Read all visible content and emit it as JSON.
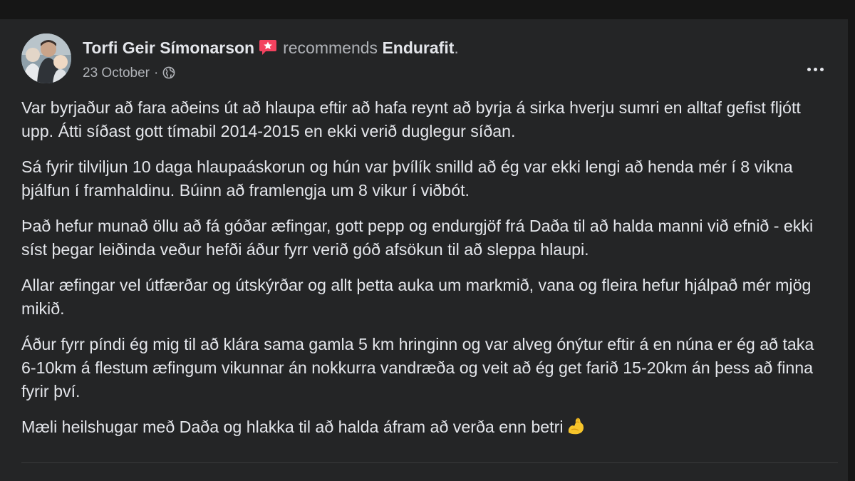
{
  "post": {
    "author": "Torfi Geir Símonarson",
    "action": "recommends",
    "page": "Endurafit",
    "page_suffix": ".",
    "date": "23 October",
    "separator": "·",
    "audience_icon": "globe-icon",
    "recommend_icon": "recommend-badge-icon",
    "more_icon": "more-options-icon",
    "paragraphs": [
      "Var byrjaður að fara aðeins út að hlaupa eftir að hafa reynt að byrja á sirka hverju sumri en alltaf gefist fljótt upp. Átti síðast gott tímabil 2014-2015 en ekki verið duglegur síðan.",
      "Sá fyrir tilviljun 10 daga hlaupaáskorun og hún var þvílík snilld að ég var ekki lengi að henda mér í 8 vikna þjálfun í framhaldinu. Búinn að framlengja um 8 vikur í viðbót.",
      "Það hefur munað öllu að fá góðar æfingar, gott pepp og endurgjöf frá Daða til að halda manni við efnið - ekki síst þegar leiðinda veður hefði áður fyrr verið góð afsökun til að sleppa hlaupi.",
      "Allar æfingar vel útfærðar og útskýrðar og allt þetta auka um markmið, vana og fleira hefur hjálpað mér mjög mikið.",
      "Áður fyrr píndi ég mig til að klára sama gamla 5 km hringinn og var alveg ónýtur eftir á en núna er ég að taka 6-10km á flestum æfingum vikunnar án nokkurra vandræða og veit að ég get farið 15-20km án þess að finna fyrir því.",
      "Mæli heilshugar með Daða og hlakka til að halda áfram að verða enn betri"
    ],
    "final_emoji": "flexed-biceps-icon"
  },
  "colors": {
    "background": "#242526",
    "text": "#e4e6eb",
    "secondary_text": "#b0b3b8",
    "recommend_badge": "#f3425f"
  }
}
